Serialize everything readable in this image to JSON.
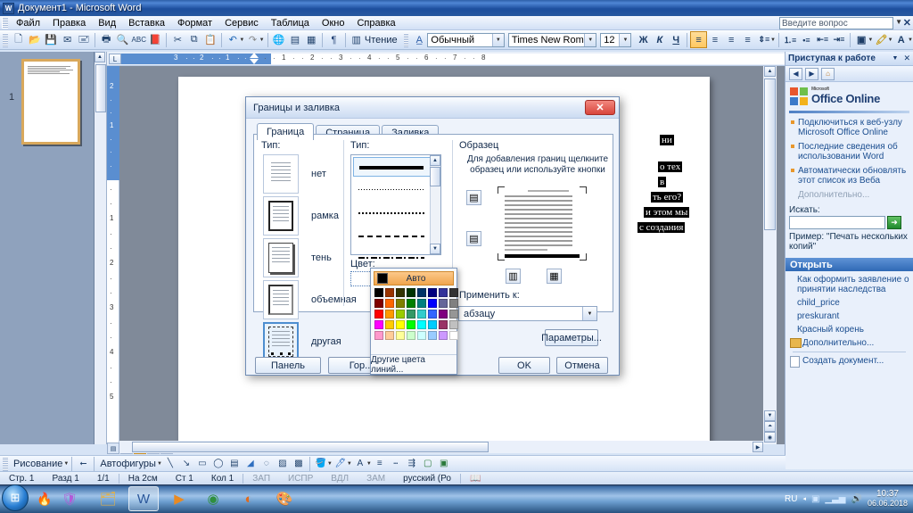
{
  "window": {
    "title": "Документ1 - Microsoft Word",
    "app_icon": "word-icon"
  },
  "menubar": {
    "items": [
      "Файл",
      "Правка",
      "Вид",
      "Вставка",
      "Формат",
      "Сервис",
      "Таблица",
      "Окно",
      "Справка"
    ],
    "ask_placeholder": "Введите вопрос"
  },
  "toolbar": {
    "buttons": [
      {
        "name": "new-document",
        "glyph": "🗋"
      },
      {
        "name": "open-folder",
        "glyph": "📂"
      },
      {
        "name": "save",
        "glyph": "💾"
      },
      {
        "name": "email",
        "glyph": "📧"
      },
      {
        "name": "permission",
        "glyph": "🖃"
      },
      {
        "name": "print",
        "glyph": "🖨"
      },
      {
        "name": "print-preview",
        "glyph": "🔍"
      },
      {
        "name": "spelling",
        "glyph": "ABC"
      },
      {
        "name": "research",
        "glyph": "📕"
      },
      {
        "name": "cut",
        "glyph": "✂"
      },
      {
        "name": "copy",
        "glyph": "⧉"
      },
      {
        "name": "paste",
        "glyph": "📋"
      },
      {
        "name": "undo",
        "glyph": "↩"
      },
      {
        "name": "redo",
        "glyph": "↪"
      },
      {
        "name": "hyperlink",
        "glyph": "🌐"
      },
      {
        "name": "tables-borders",
        "glyph": "▤"
      },
      {
        "name": "insert-table",
        "glyph": "▦"
      },
      {
        "name": "show-formatting",
        "glyph": "¶"
      }
    ],
    "reading_label": "Чтение",
    "style_value": "Обычный",
    "font_value": "Times New Roman",
    "size_value": "12",
    "bold_label": "Ж",
    "italic_label": "К",
    "underline_label": "Ч"
  },
  "ruler": {
    "h_ticks": [
      "3",
      "2",
      "1",
      "1",
      "2",
      "3",
      "4",
      "5",
      "6",
      "7",
      "8"
    ],
    "v_ticks": [
      "2",
      "1",
      "1",
      "2",
      "3",
      "4",
      "5"
    ]
  },
  "thumbnail": {
    "page_number": "1"
  },
  "document": {
    "selected_lines": [
      "ни",
      "о тех",
      "в",
      "ть его?",
      "и этом мы",
      "с создания"
    ]
  },
  "dialog": {
    "title": "Границы и заливка",
    "close_glyph": "✕",
    "tabs": [
      {
        "label": "Граница",
        "active": true
      },
      {
        "label": "Страница",
        "active": false
      },
      {
        "label": "Заливка",
        "active": false
      }
    ],
    "type_label": "Тип:",
    "border_types": [
      {
        "label": "нет",
        "selected": false
      },
      {
        "label": "рамка",
        "selected": false
      },
      {
        "label": "тень",
        "selected": false
      },
      {
        "label": "объемная",
        "selected": false
      },
      {
        "label": "другая",
        "selected": true
      }
    ],
    "style_label": "Тип:",
    "line_styles": [
      "solid-thick",
      "dotted-fine",
      "dotted",
      "dashed",
      "dash-dot"
    ],
    "color_label": "Цвет:",
    "color_value": "Авто",
    "preview_label": "Образец",
    "preview_hint_line1": "Для добавления границ щелкните",
    "preview_hint_line2": "образец или используйте кнопки",
    "apply_label": "Применить к:",
    "apply_value": "абзацу",
    "options_button": "Параметры...",
    "panel_button": "Панель",
    "horiz_button": "Гор...",
    "ok_button": "OK",
    "cancel_button": "Отмена"
  },
  "color_dropdown": {
    "auto_label": "Авто",
    "auto_swatch": "#000000",
    "more_label": "Другие цвета линий...",
    "palette": [
      "#000000",
      "#993300",
      "#333300",
      "#003300",
      "#003366",
      "#000080",
      "#333399",
      "#333333",
      "#800000",
      "#FF6600",
      "#808000",
      "#008000",
      "#008080",
      "#0000FF",
      "#666699",
      "#808080",
      "#FF0000",
      "#FF9900",
      "#99CC00",
      "#339966",
      "#33CCCC",
      "#3366FF",
      "#800080",
      "#969696",
      "#FF00FF",
      "#FFCC00",
      "#FFFF00",
      "#00FF00",
      "#00FFFF",
      "#00CCFF",
      "#993366",
      "#C0C0C0",
      "#FF99CC",
      "#FFCC99",
      "#FFFF99",
      "#CCFFCC",
      "#CCFFFF",
      "#99CCFF",
      "#CC99FF",
      "#FFFFFF"
    ]
  },
  "taskpane": {
    "title": "Приступая к работе",
    "close_glyph": "✕",
    "dropdown_glyph": "▼",
    "nav": [
      "back-icon",
      "forward-icon",
      "home-icon"
    ],
    "brand_sup": "Microsoft",
    "brand": "Office Online",
    "bullets": [
      "Подключиться к веб-узлу Microsoft Office Online",
      "Последние сведения об использовании Word",
      "Автоматически обновлять этот список из Веба"
    ],
    "more_label": "Дополнительно...",
    "search_label": "Искать:",
    "search_value": "",
    "go_glyph": "➜",
    "example_label": "Пример:",
    "example_value": "\"Печать нескольких копий\"",
    "open_section": "Открыть",
    "open_links": [
      "Как оформить заявление о принятии наследства",
      "child_price",
      "preskurant",
      "Красный корень"
    ],
    "more_open": "Дополнительно...",
    "new_doc": "Создать документ..."
  },
  "drawbar": {
    "draw_label": "Рисование",
    "autoshapes_label": "Автофигуры",
    "tools": [
      "line-icon",
      "arrow-icon",
      "rect-icon",
      "ellipse-icon",
      "textbox-icon",
      "wordart-icon",
      "diagram-icon",
      "clipart-icon",
      "picture-icon",
      "fill-icon",
      "linecolor-icon",
      "fontcolor-icon",
      "linestyle-icon",
      "dashstyle-icon",
      "arrowstyle-icon",
      "shadow-icon",
      "3d-icon"
    ]
  },
  "statusbar": {
    "page": "Стр. 1",
    "section": "Разд 1",
    "pages": "1/1",
    "at": "На 2см",
    "line": "Ст 1",
    "col": "Кол 1",
    "rec": "ЗАП",
    "trk": "ИСПР",
    "ext": "ВДЛ",
    "ovr": "ЗАМ",
    "language": "русский (Ро",
    "spell_icon": "spellcheck-icon"
  },
  "taskbar": {
    "start_glyph": "⊞",
    "pinned": [
      "flame-icon",
      "shield-icon",
      "explorer-icon",
      "word-icon",
      "media-icon",
      "chrome-icon",
      "firefox-icon",
      "paint-icon"
    ],
    "tray_lang": "RU",
    "tray_icons": [
      "action-center-icon",
      "network-icon",
      "volume-icon"
    ],
    "clock_time": "10:37",
    "clock_date": "06.06.2018"
  }
}
